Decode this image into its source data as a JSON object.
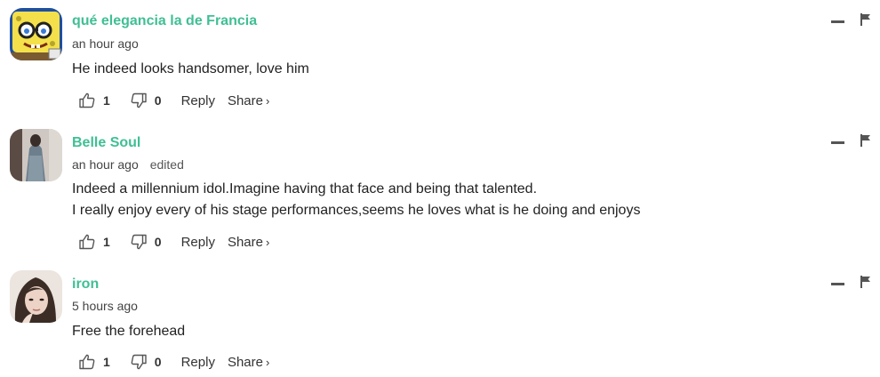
{
  "comments": [
    {
      "author": "qué elegancia la de Francia",
      "time": "an hour ago",
      "edited": "",
      "lines": [
        "He indeed looks handsomer, love him"
      ],
      "likes": "1",
      "dislikes": "0",
      "reply_label": "Reply",
      "share_label": "Share",
      "avatar_icon": "spongebob-avatar"
    },
    {
      "author": "Belle Soul",
      "time": "an hour ago",
      "edited": "edited",
      "lines": [
        "Indeed a millennium idol.Imagine having that face and being that talented.",
        "I really enjoy every of his stage performances,seems he loves what is he doing and enjoys"
      ],
      "likes": "1",
      "dislikes": "0",
      "reply_label": "Reply",
      "share_label": "Share",
      "avatar_icon": "person-photo-avatar"
    },
    {
      "author": "iron",
      "time": "5 hours ago",
      "edited": "",
      "lines": [
        "Free the forehead"
      ],
      "likes": "1",
      "dislikes": "0",
      "reply_label": "Reply",
      "share_label": "Share",
      "avatar_icon": "portrait-photo-avatar"
    }
  ],
  "colors": {
    "author": "#3fbf94",
    "text": "#222222",
    "meta": "#444444"
  },
  "icons": {
    "like": "thumbs-up-icon",
    "dislike": "thumbs-down-icon",
    "collapse": "minus-icon",
    "flag": "flag-icon",
    "share_chevron": "›"
  }
}
